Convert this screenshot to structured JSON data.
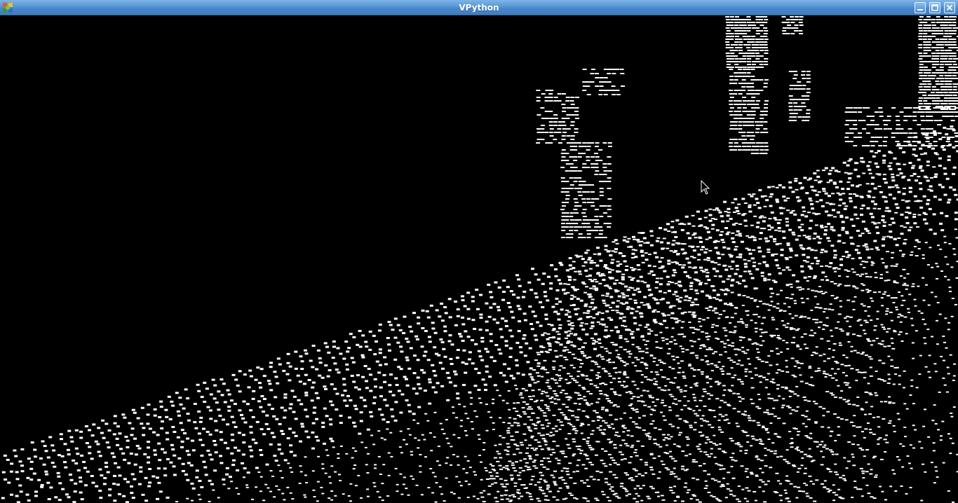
{
  "window": {
    "title": "VPython",
    "icon": "vpython-app-icon",
    "controls": {
      "minimize_icon": "minimize-icon",
      "maximize_icon": "maximize-icon",
      "close_icon": "close-icon"
    }
  },
  "scene": {
    "background": "#000000",
    "point_color": "#ffffff",
    "titlebar_color": "#4a87c9"
  }
}
